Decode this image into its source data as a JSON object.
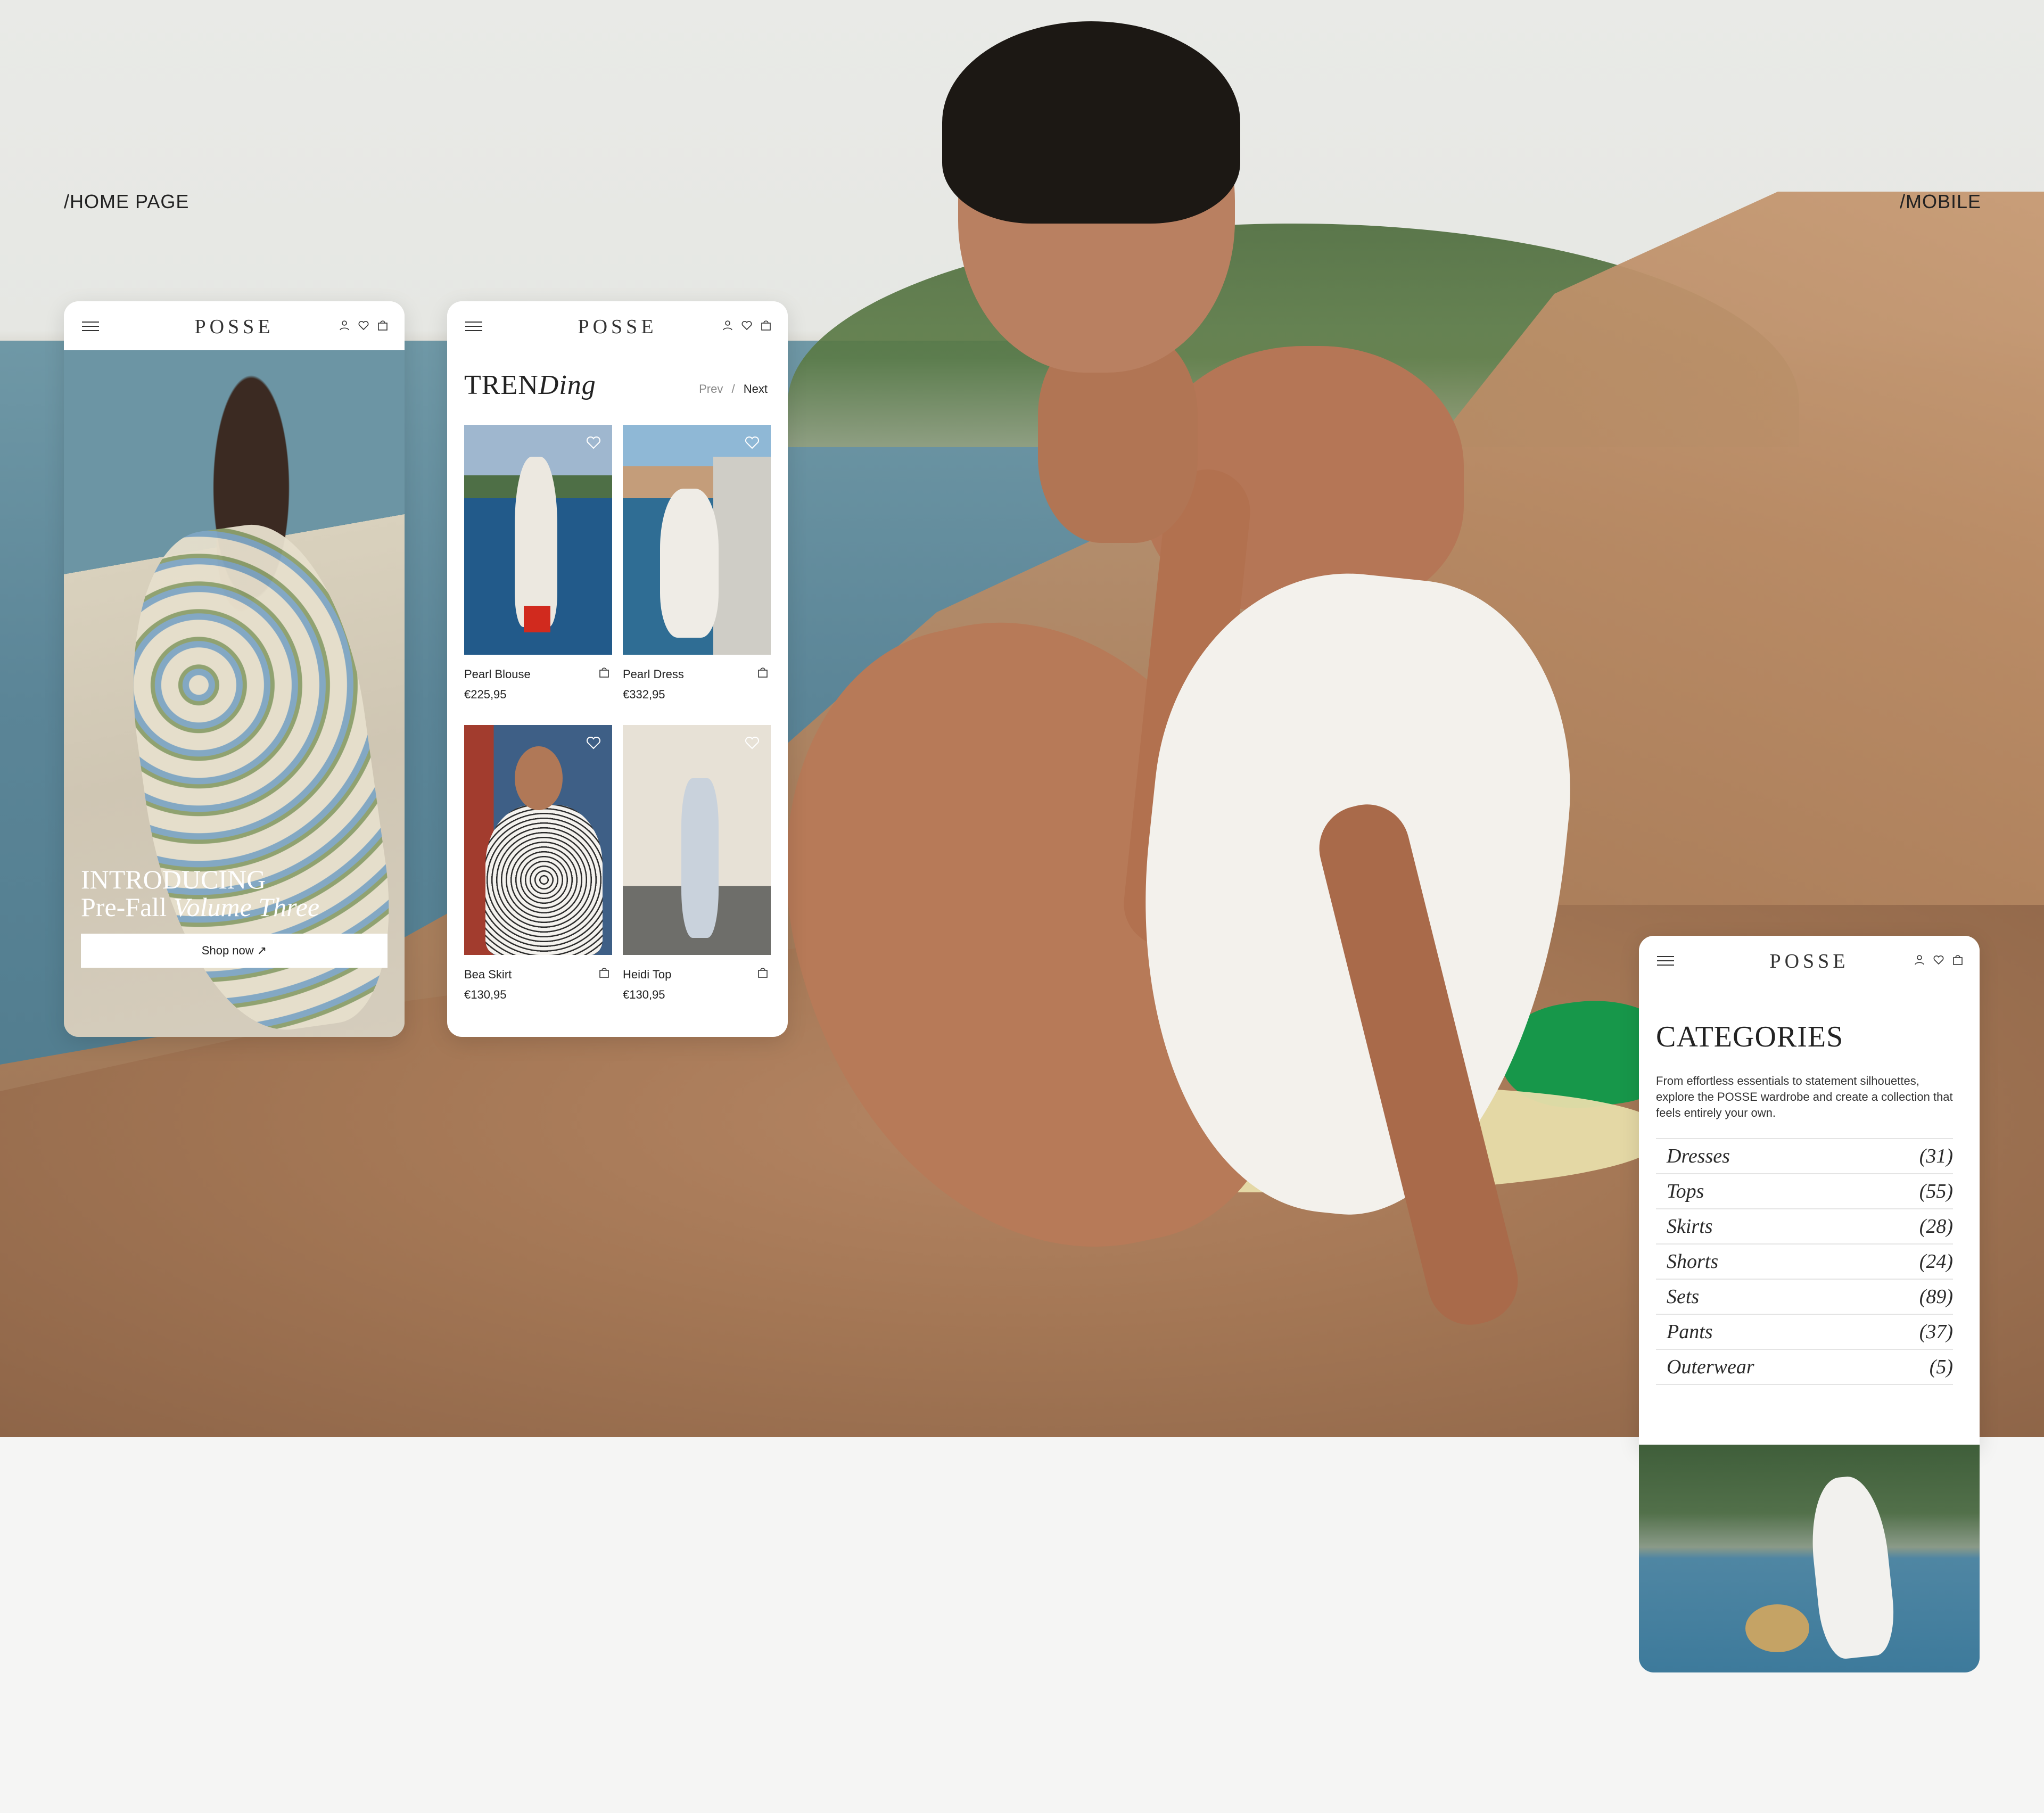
{
  "labels": {
    "left": "/HOME PAGE",
    "right": "/MOBILE"
  },
  "brand": "POSSE",
  "icons": [
    "menu-icon",
    "user-icon",
    "heart-icon",
    "bag-icon"
  ],
  "home": {
    "hero_line1": "INTRODUCING",
    "hero_line2a": "Pre-Fall ",
    "hero_line2b": "Volume Three",
    "cta": "Shop now ↗"
  },
  "trending": {
    "title_a": "TREN",
    "title_b": "Ding",
    "prev": "Prev",
    "sep": "/",
    "next": "Next",
    "products": [
      {
        "name": "Pearl Blouse",
        "price": "€225,95"
      },
      {
        "name": "Pearl Dress",
        "price": "€332,95"
      },
      {
        "name": "Bea Skirt",
        "price": "€130,95"
      },
      {
        "name": "Heidi Top",
        "price": "€130,95"
      }
    ]
  },
  "categories": {
    "title": "CATEGORIES",
    "description": "From effortless essentials to statement silhouettes, explore the POSSE wardrobe and create a collection that feels entirely your own.",
    "items": [
      {
        "name": "Dresses",
        "count": "(31)"
      },
      {
        "name": "Tops",
        "count": "(55)"
      },
      {
        "name": "Skirts",
        "count": "(28)"
      },
      {
        "name": "Shorts",
        "count": "(24)"
      },
      {
        "name": "Sets",
        "count": "(89)"
      },
      {
        "name": "Pants",
        "count": "(37)"
      },
      {
        "name": "Outerwear",
        "count": "(5)"
      }
    ]
  }
}
